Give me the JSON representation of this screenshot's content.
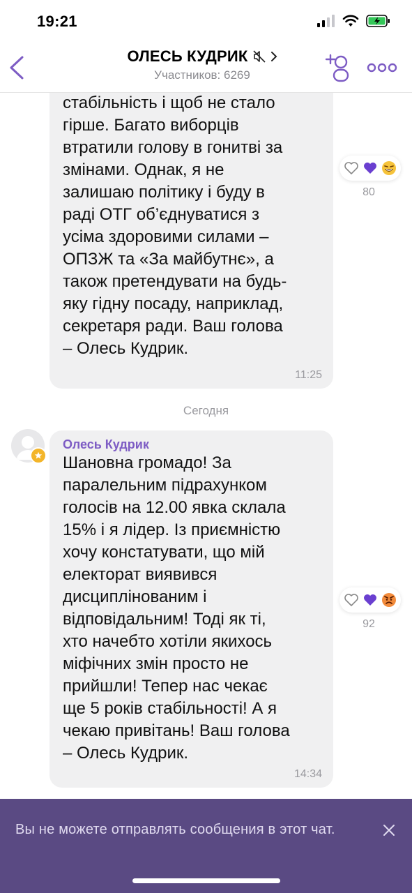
{
  "status_bar": {
    "time": "19:21"
  },
  "header": {
    "title": "ОЛЕСЬ КУДРИК",
    "subtitle": "Участников: 6269",
    "icons": [
      "back-chevron-icon",
      "muted-speaker-icon",
      "chevron-right-icon",
      "add-user-icon",
      "more-dots-icon"
    ],
    "accent_color": "#7d5cc4"
  },
  "messages": [
    {
      "text": "результат, що головне – це\nстабільність і щоб не стало\nгірше. Багато виборців\nвтратили голову в гонитві за\nзмінами. Однак, я не\nзалишаю політику і буду в\nраді ОТГ об’єднуватися з\nусіма здоровими силами –\nОПЗЖ та «За майбутнє», а\nтакож претендувати на будь-\nяку гідну посаду, наприклад,\nсекретаря ради. Ваш голова\n– Олесь Кудрик.",
      "time": "11:25",
      "reactions": {
        "icons": [
          "heart-outline-icon",
          "purple-heart-icon",
          "laughing-emoji-icon"
        ],
        "count": "80"
      }
    },
    {
      "sender": "Олесь Кудрик",
      "text": "Шановна громадо! За\nпаралельним підрахунком\nголосів на 12.00 явка склала\n15% і я лідер. Із приємністю\nхочу констатувати, що мій\nелекторат виявився\nдисциплінованим і\nвідповідальним! Тоді як ті,\nхто начебто хотіли якихось\nміфічних змін просто не\nприйшли! Тепер нас чекає\nще 5 років стабільності! А я\nчекаю привітань! Ваш голова\n– Олесь Кудрик.",
      "time": "14:34",
      "reactions": {
        "icons": [
          "heart-outline-icon",
          "purple-heart-icon",
          "angry-emoji-icon"
        ],
        "count": "92"
      }
    }
  ],
  "date_separator": "Сегодня",
  "notice": {
    "text": "Вы не можете отправлять сообщения в этот чат."
  }
}
